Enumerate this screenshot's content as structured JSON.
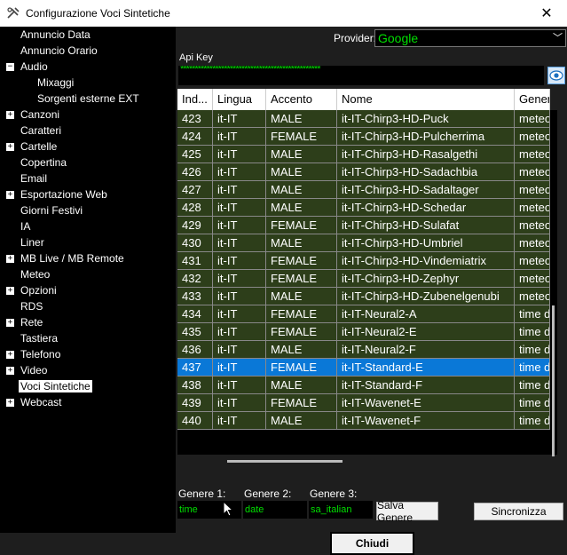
{
  "window": {
    "title": "Configurazione Voci Sintetiche",
    "close": "✕"
  },
  "tree": [
    {
      "label": "Annuncio Data",
      "exp": ""
    },
    {
      "label": "Annuncio Orario",
      "exp": ""
    },
    {
      "label": "Audio",
      "exp": "−"
    },
    {
      "label": "Mixaggi",
      "exp": ""
    },
    {
      "label": "Sorgenti esterne EXT",
      "exp": ""
    },
    {
      "label": "Canzoni",
      "exp": "+"
    },
    {
      "label": "Caratteri",
      "exp": ""
    },
    {
      "label": "Cartelle",
      "exp": "+"
    },
    {
      "label": "Copertina",
      "exp": ""
    },
    {
      "label": "Email",
      "exp": ""
    },
    {
      "label": "Esportazione Web",
      "exp": "+"
    },
    {
      "label": "Giorni Festivi",
      "exp": ""
    },
    {
      "label": "IA",
      "exp": ""
    },
    {
      "label": "Liner",
      "exp": ""
    },
    {
      "label": "MB Live / MB Remote",
      "exp": "+"
    },
    {
      "label": "Meteo",
      "exp": ""
    },
    {
      "label": "Opzioni",
      "exp": "+"
    },
    {
      "label": "RDS",
      "exp": ""
    },
    {
      "label": "Rete",
      "exp": "+"
    },
    {
      "label": "Tastiera",
      "exp": ""
    },
    {
      "label": "Telefono",
      "exp": "+"
    },
    {
      "label": "Video",
      "exp": "+"
    },
    {
      "label": "Voci Sintetiche",
      "exp": ""
    },
    {
      "label": "Webcast",
      "exp": "+"
    }
  ],
  "provider": {
    "label": "Provider:",
    "value": "Google",
    "chevron": "﹀"
  },
  "apikey": {
    "label": "Api Key",
    "value": "************************************************"
  },
  "grid": {
    "headers": [
      "Ind...",
      "Lingua",
      "Accento",
      "Nome",
      "Genere"
    ],
    "rows": [
      [
        "423",
        "it-IT",
        "MALE",
        "it-IT-Chirp3-HD-Puck",
        "meteo"
      ],
      [
        "424",
        "it-IT",
        "FEMALE",
        "it-IT-Chirp3-HD-Pulcherrima",
        "meteo"
      ],
      [
        "425",
        "it-IT",
        "MALE",
        "it-IT-Chirp3-HD-Rasalgethi",
        "meteo"
      ],
      [
        "426",
        "it-IT",
        "MALE",
        "it-IT-Chirp3-HD-Sadachbia",
        "meteo"
      ],
      [
        "427",
        "it-IT",
        "MALE",
        "it-IT-Chirp3-HD-Sadaltager",
        "meteo"
      ],
      [
        "428",
        "it-IT",
        "MALE",
        "it-IT-Chirp3-HD-Schedar",
        "meteo"
      ],
      [
        "429",
        "it-IT",
        "FEMALE",
        "it-IT-Chirp3-HD-Sulafat",
        "meteo"
      ],
      [
        "430",
        "it-IT",
        "MALE",
        "it-IT-Chirp3-HD-Umbriel",
        "meteo"
      ],
      [
        "431",
        "it-IT",
        "FEMALE",
        "it-IT-Chirp3-HD-Vindemiatrix",
        "meteo"
      ],
      [
        "432",
        "it-IT",
        "FEMALE",
        "it-IT-Chirp3-HD-Zephyr",
        "meteo"
      ],
      [
        "433",
        "it-IT",
        "MALE",
        "it-IT-Chirp3-HD-Zubenelgenubi",
        "meteo"
      ],
      [
        "434",
        "it-IT",
        "FEMALE",
        "it-IT-Neural2-A",
        "time d"
      ],
      [
        "435",
        "it-IT",
        "FEMALE",
        "it-IT-Neural2-E",
        "time d"
      ],
      [
        "436",
        "it-IT",
        "MALE",
        "it-IT-Neural2-F",
        "time d"
      ],
      [
        "437",
        "it-IT",
        "FEMALE",
        "it-IT-Standard-E",
        "time d"
      ],
      [
        "438",
        "it-IT",
        "MALE",
        "it-IT-Standard-F",
        "time d"
      ],
      [
        "439",
        "it-IT",
        "FEMALE",
        "it-IT-Wavenet-E",
        "time d"
      ],
      [
        "440",
        "it-IT",
        "MALE",
        "it-IT-Wavenet-F",
        "time d"
      ]
    ],
    "selected_index": "437"
  },
  "genere": {
    "g1_label": "Genere 1:",
    "g1_value": "time",
    "g2_label": "Genere 2:",
    "g2_value": "date",
    "g3_label": "Genere 3:",
    "g3_value": "sa_italian"
  },
  "buttons": {
    "salva": "Salva Genere",
    "sincronizza": "Sincronizza",
    "chiudi": "Chiudi"
  }
}
